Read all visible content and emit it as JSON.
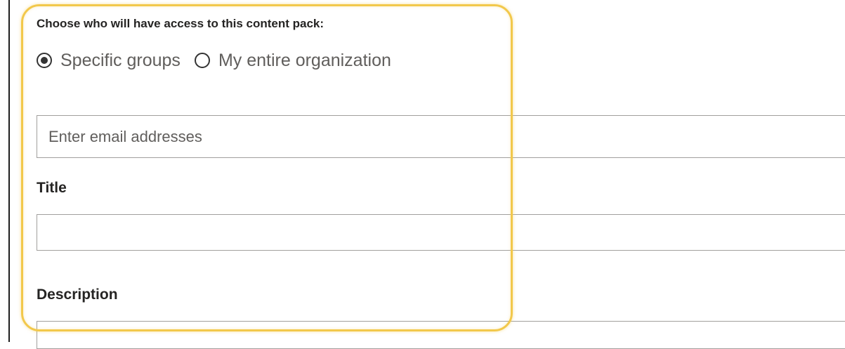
{
  "access": {
    "heading": "Choose who will have access to this content pack:",
    "options": [
      {
        "label": "Specific groups",
        "selected": true
      },
      {
        "label": "My entire organization",
        "selected": false
      }
    ],
    "email_placeholder": "Enter email addresses",
    "email_value": ""
  },
  "title_section": {
    "label": "Title",
    "value": ""
  },
  "description_section": {
    "label": "Description",
    "value": ""
  },
  "colors": {
    "highlight": "#f2c84b",
    "field_border": "#a19f9d",
    "text": "#252423",
    "muted_text": "#605e5c"
  }
}
